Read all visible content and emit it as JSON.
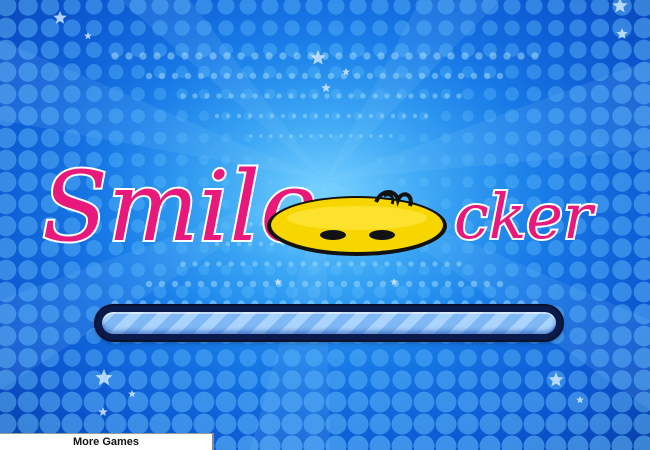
{
  "game": {
    "title_part1": "Smile",
    "title_part2": "cker"
  },
  "loader": {
    "progress": 1.0
  },
  "footer": {
    "more_games_label": "More Games"
  },
  "colors": {
    "title_pink": "#e8197a",
    "smiley_yellow": "#f7d600",
    "background_blue": "#1577e6",
    "dot_color": "#6cc6ff"
  }
}
